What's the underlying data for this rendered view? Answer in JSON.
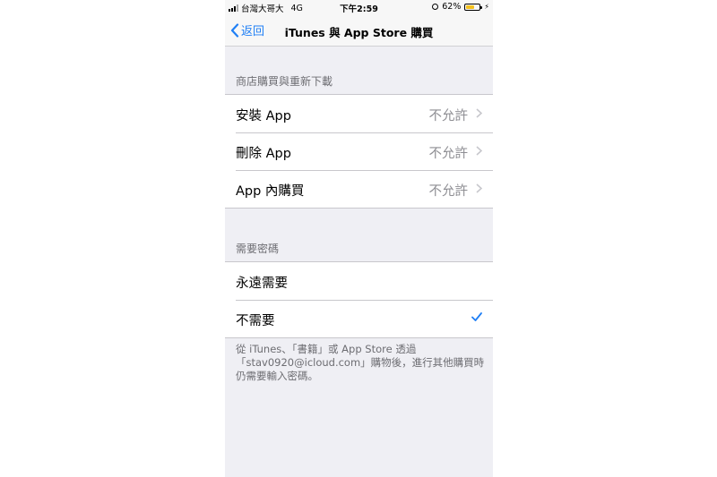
{
  "status_bar": {
    "carrier": "台灣大哥大",
    "network": "4G",
    "time": "下午2:59",
    "battery": "62%",
    "battery_level": 0.62,
    "battery_color": "#f3c01b"
  },
  "nav": {
    "back_label": "返回",
    "title": "iTunes 與 App Store 購買",
    "accent_color": "#1f7ff5"
  },
  "section1": {
    "header": "商店購買與重新下載",
    "rows": [
      {
        "label": "安裝 App",
        "value": "不允許"
      },
      {
        "label": "刪除 App",
        "value": "不允許"
      },
      {
        "label": "App 內購買",
        "value": "不允許"
      }
    ]
  },
  "section2": {
    "header": "需要密碼",
    "rows": [
      {
        "label": "永遠需要"
      },
      {
        "label": "不需要"
      }
    ],
    "selected_index": 1,
    "footer": "從 iTunes、「書籍」或 App Store 透過「stav0920@icloud.com」購物後，進行其他購買時仍需要輸入密碼。"
  },
  "icons": {
    "back": "chevron-left-icon",
    "disclosure": "chevron-right-icon",
    "selected": "checkmark-icon",
    "alarm": "alarm-icon",
    "charging": "bolt-icon"
  }
}
